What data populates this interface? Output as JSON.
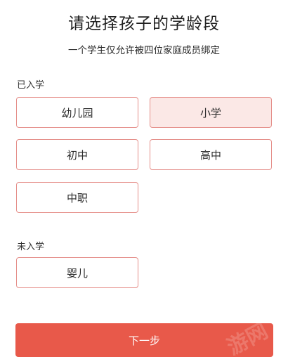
{
  "page": {
    "title": "请选择孩子的学龄段",
    "subtitle": "一个学生仅允许被四位家庭成员绑定"
  },
  "enrolled": {
    "label": "已入学",
    "options": [
      "幼儿园",
      "小学",
      "初中",
      "高中",
      "中职"
    ],
    "selected": "小学"
  },
  "not_enrolled": {
    "label": "未入学",
    "options": [
      "婴儿"
    ]
  },
  "footer": {
    "next_label": "下一步",
    "watermark": "游网"
  },
  "colors": {
    "accent": "#e8594a",
    "option_border": "#e58f8a",
    "selected_bg": "#fbe8e6"
  }
}
